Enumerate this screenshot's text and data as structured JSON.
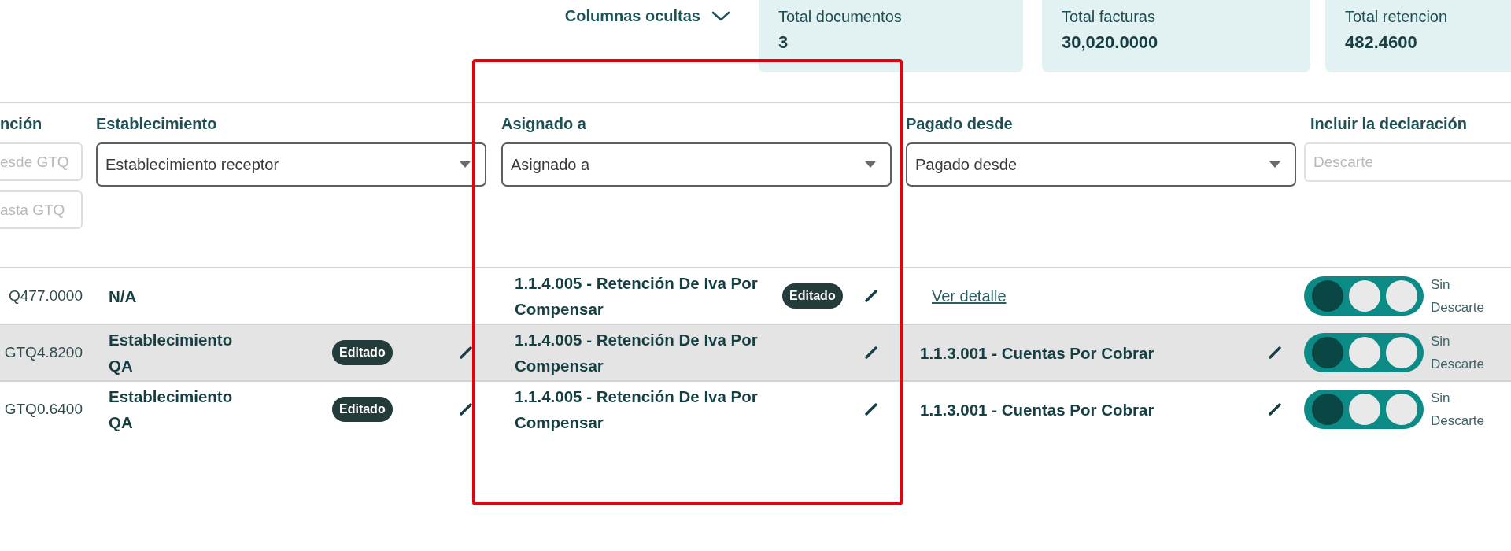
{
  "hidden_columns": {
    "label": "Columnas ocultas"
  },
  "summary": [
    {
      "label": "Total documentos",
      "value": "3"
    },
    {
      "label": "Total facturas",
      "value": "30,020.0000"
    },
    {
      "label": "Total retencion",
      "value": "482.4600"
    }
  ],
  "table": {
    "columns": [
      {
        "kind": "range",
        "header": "nción",
        "highlighted": false,
        "fields": [
          {
            "placeholder": "esde GTQ"
          },
          {
            "placeholder": "asta GTQ"
          }
        ]
      },
      {
        "kind": "select",
        "header": "Establecimiento",
        "highlighted": false,
        "value": "Establecimiento receptor"
      },
      {
        "kind": "select",
        "header": "Asignado a",
        "highlighted": true,
        "value": "Asignado a"
      },
      {
        "kind": "select",
        "header": "Pagado desde",
        "highlighted": false,
        "value": "Pagado desde"
      },
      {
        "kind": "input",
        "header": "Incluir la declaración",
        "highlighted": false,
        "placeholder": "Descarte"
      }
    ],
    "rows": [
      {
        "highlighted": false,
        "amount": "Q477.0000",
        "establishment": {
          "text": "N/A",
          "editable": false
        },
        "assigned": {
          "text": "1.1.4.005 - Retención De Iva Por Compensar",
          "badge": "Editado",
          "editable": true
        },
        "paid": {
          "kind": "link",
          "text": "Ver detalle",
          "editable": false
        },
        "declaration": {
          "positions": [
            {
              "selected": true
            },
            {
              "selected": false
            },
            {
              "selected": false
            }
          ],
          "label": "Sin Descarte"
        }
      },
      {
        "highlighted": true,
        "amount": "GTQ4.8200",
        "establishment": {
          "text": "Establecimiento QA",
          "badge": "Editado",
          "editable": true
        },
        "assigned": {
          "text": "1.1.4.005 - Retención De Iva Por Compensar",
          "editable": true
        },
        "paid": {
          "kind": "text",
          "text": "1.1.3.001 - Cuentas Por Cobrar",
          "editable": true
        },
        "declaration": {
          "positions": [
            {
              "selected": true
            },
            {
              "selected": false
            },
            {
              "selected": false
            }
          ],
          "label": "Sin Descarte"
        }
      },
      {
        "highlighted": false,
        "amount": "GTQ0.6400",
        "establishment": {
          "text": "Establecimiento QA",
          "badge": "Editado",
          "editable": true
        },
        "assigned": {
          "text": "1.1.4.005 - Retención De Iva Por Compensar",
          "editable": true
        },
        "paid": {
          "kind": "text",
          "text": "1.1.3.001 - Cuentas Por Cobrar",
          "editable": true
        },
        "declaration": {
          "positions": [
            {
              "selected": true
            },
            {
              "selected": false
            },
            {
              "selected": false
            }
          ],
          "label": "Sin Descarte"
        }
      }
    ]
  }
}
